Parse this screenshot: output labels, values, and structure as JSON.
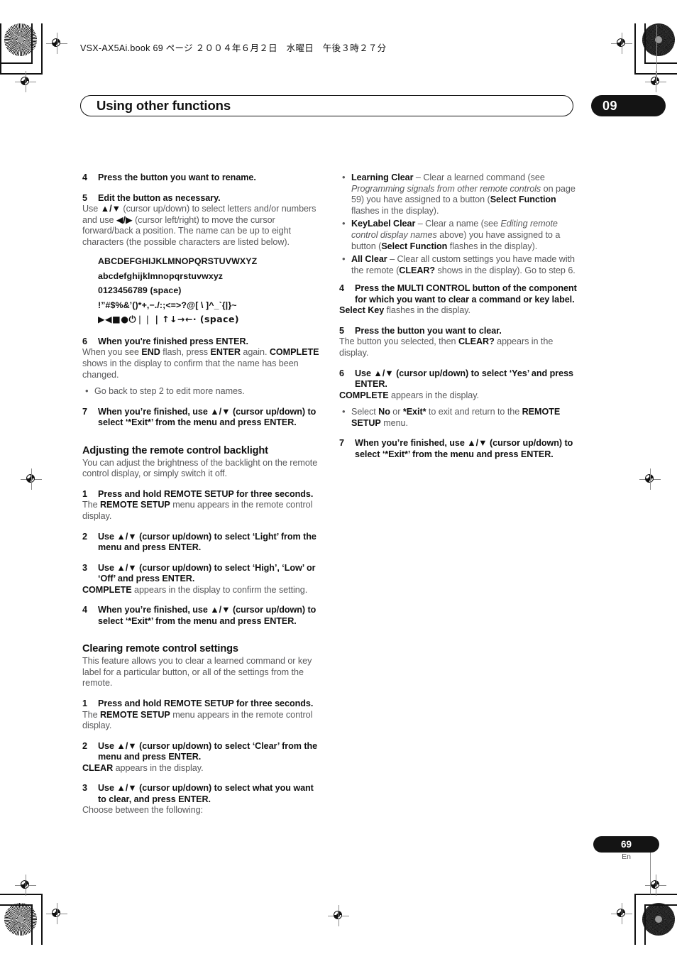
{
  "header": {
    "slug": "VSX-AX5Ai.book  69 ページ  ２００４年６月２日　水曜日　午後３時２７分",
    "chapter_title": "Using other functions",
    "chapter_number": "09"
  },
  "footer": {
    "page_number": "69",
    "language": "En"
  },
  "left_column": {
    "step4": {
      "num": "4",
      "head": "Press the button you want to rename."
    },
    "step5": {
      "num": "5",
      "head": "Edit the button as necessary.",
      "body_1": "Use ",
      "body_updown": "▲/▼",
      "body_2": " (cursor up/down) to select letters and/or numbers and use ",
      "body_leftright": "◀/▶",
      "body_3": " (cursor left/right) to move the cursor forward/back a position. The name can be up to eight characters (the possible characters are listed below)."
    },
    "characters": [
      "ABCDEFGHIJKLMNOPQRSTUVWXYZ",
      "abcdefghijklmnopqrstuvwxyz",
      "0123456789 (space)",
      "!”#$%&’()*+,−./:;<=>?@[ \\ ]^_`{|}~",
      "▶◀■●⏻❘❘ | ↑↓→←· (space)"
    ],
    "step6": {
      "num": "6",
      "head": "When you're finished press ENTER.",
      "body_1": "When you see ",
      "body_end": "END",
      "body_2": " flash, press ",
      "body_enter": "ENTER",
      "body_3": " again. ",
      "body_complete": "COMPLETE",
      "body_4": " shows in the display to confirm that the name has been changed.",
      "bullet": "Go back to step 2 to edit more names."
    },
    "step7": {
      "num": "7",
      "head_1": "When you’re finished, use ",
      "head_updown": "▲/▼",
      "head_2": " (cursor up/down) to select ‘*Exit*’ from the menu and press ENTER."
    },
    "backlight_section": {
      "heading": "Adjusting the remote control backlight",
      "intro": "You can adjust the brightness of the backlight on the remote control display, or simply switch it off.",
      "step1": {
        "num": "1",
        "head": "Press and hold REMOTE SETUP for three seconds.",
        "body_1": "The ",
        "body_bold": "REMOTE SETUP",
        "body_2": " menu appears in the remote control display."
      },
      "step2": {
        "num": "2",
        "head_1": "Use ",
        "head_updown": "▲/▼",
        "head_2": " (cursor up/down) to select ‘Light’ from the menu and press ENTER."
      },
      "step3": {
        "num": "3",
        "head_1": "Use ",
        "head_updown": "▲/▼",
        "head_2": " (cursor up/down) to select ‘High’, ‘Low’ or ‘Off’ and press ENTER.",
        "body_bold": "COMPLETE",
        "body_2": " appears in the display to confirm the setting."
      },
      "step4": {
        "num": "4",
        "head_1": "When you’re finished, use ",
        "head_updown": "▲/▼",
        "head_2": " (cursor up/down) to select ‘*Exit*’ from the menu and press ENTER."
      }
    },
    "clearing_section": {
      "heading": "Clearing remote control settings",
      "intro": "This feature allows you to clear a learned command or key label for a particular button, or all of the settings from the remote.",
      "step1": {
        "num": "1",
        "head": "Press and hold REMOTE SETUP for three seconds.",
        "body_1": "The ",
        "body_bold": "REMOTE SETUP",
        "body_2": " menu appears in the remote control display."
      },
      "step2": {
        "num": "2",
        "head_1": "Use ",
        "head_updown": "▲/▼",
        "head_2": " (cursor up/down) to select ‘Clear’ from the menu and press ENTER.",
        "body_bold": "CLEAR",
        "body_2": " appears in the display."
      },
      "step3": {
        "num": "3",
        "head_1": "Use ",
        "head_updown": "▲/▼",
        "head_2": " (cursor up/down) to select what you want to clear, and press ENTER.",
        "body": "Choose between the following:"
      }
    }
  },
  "right_column": {
    "clear_options": [
      {
        "name": "Learning Clear",
        "dash": " – Clear a learned command (see ",
        "italic": "Programming signals from other remote controls",
        "mid": " on page 59) you have assigned to a button (",
        "bold2": "Select Function",
        "tail": " flashes in the display)."
      },
      {
        "name": "KeyLabel Clear",
        "dash": " – Clear a name (see ",
        "italic": "Editing remote control display names",
        "mid": " above) you have assigned to a button (",
        "bold2": "Select Function",
        "tail": " flashes in the display)."
      },
      {
        "name": "All Clear",
        "dash": " – Clear all custom settings you have made with the remote (",
        "italic": "",
        "mid": "",
        "bold2": "CLEAR?",
        "tail": " shows in the display). Go to step 6."
      }
    ],
    "step4": {
      "num": "4",
      "head": "Press the MULTI CONTROL button of the component for which you want to clear a command or key label.",
      "body_bold": "Select Key",
      "body_2": " flashes in the display."
    },
    "step5": {
      "num": "5",
      "head": "Press the button you want to clear.",
      "body_1": "The button you selected, then ",
      "body_bold": "CLEAR?",
      "body_2": " appears in the display."
    },
    "step6": {
      "num": "6",
      "head_1": "Use ",
      "head_updown": "▲/▼",
      "head_2": " (cursor up/down) to select ‘Yes’ and press ENTER.",
      "body_bold": "COMPLETE",
      "body_2": " appears in the display.",
      "bullet_1": "Select ",
      "bullet_no": "No",
      "bullet_2": " or ",
      "bullet_exit": "*Exit*",
      "bullet_3": " to exit and return to the ",
      "bullet_setup": "REMOTE SETUP",
      "bullet_4": " menu."
    },
    "step7": {
      "num": "7",
      "head_1": "When you’re finished, use ",
      "head_updown": "▲/▼",
      "head_2": " (cursor up/down) to select ‘*Exit*’ from the menu and press ENTER."
    }
  }
}
